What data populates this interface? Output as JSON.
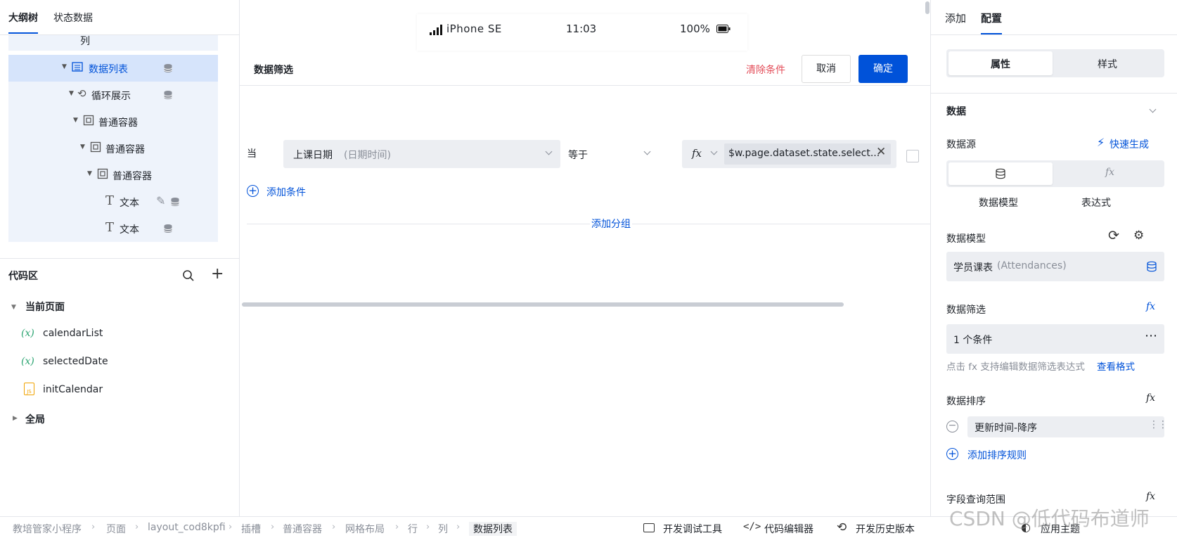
{
  "left_tabs": {
    "outline": "大纲树",
    "state": "状态数据"
  },
  "tree": {
    "partial_top": "列",
    "items": [
      {
        "label": "数据列表"
      },
      {
        "label": "循环展示"
      },
      {
        "label": "普通容器"
      },
      {
        "label": "普通容器"
      },
      {
        "label": "普通容器"
      },
      {
        "label": "文本"
      },
      {
        "label": "文本"
      }
    ]
  },
  "code_area": {
    "title": "代码区",
    "current_page": "当前页面",
    "items": [
      {
        "label": "calendarList",
        "prefix": "(x)"
      },
      {
        "label": "selectedDate",
        "prefix": "(x)"
      },
      {
        "label": "initCalendar",
        "prefix": "JS"
      }
    ],
    "global": "全局"
  },
  "phone": {
    "device": "iPhone SE",
    "time": "11:03",
    "battery": "100%"
  },
  "filter": {
    "title": "数据筛选",
    "clear": "清除条件",
    "cancel": "取消",
    "confirm": "确定",
    "when": "当",
    "field": "上课日期",
    "field_type": "(日期时间)",
    "operator": "等于",
    "fx": "fx",
    "value": "$w.page.dataset.state.select...",
    "add_condition": "添加条件",
    "add_group": "添加分组"
  },
  "right_tabs": {
    "add": "添加",
    "config": "配置"
  },
  "right": {
    "seg_props": "属性",
    "seg_style": "样式",
    "section_data": "数据",
    "datasource": "数据源",
    "quick_gen": "快速生成",
    "mode_model": "数据模型",
    "mode_expr": "表达式",
    "model_label": "数据模型",
    "model_value": "学员课表",
    "model_sub": "(Attendances)",
    "filter_label": "数据筛选",
    "filter_value": "1 个条件",
    "filter_hint": "点击 fx 支持编辑数据筛选表达式",
    "filter_hint_link": "查看格式",
    "sort_label": "数据排序",
    "sort_value": "更新时间-降序",
    "add_sort": "添加排序规则",
    "field_scope": "字段查询范围"
  },
  "breadcrumb": [
    "教培管家小程序",
    "页面",
    "layout_cod8kpfi",
    "插槽",
    "普通容器",
    "网格布局",
    "行",
    "列",
    "数据列表"
  ],
  "toolbar": {
    "debug": "开发调试工具",
    "code_editor": "代码编辑器",
    "history": "开发历史版本",
    "theme": "应用主题"
  },
  "watermark": "CSDN @低代码布道师"
}
